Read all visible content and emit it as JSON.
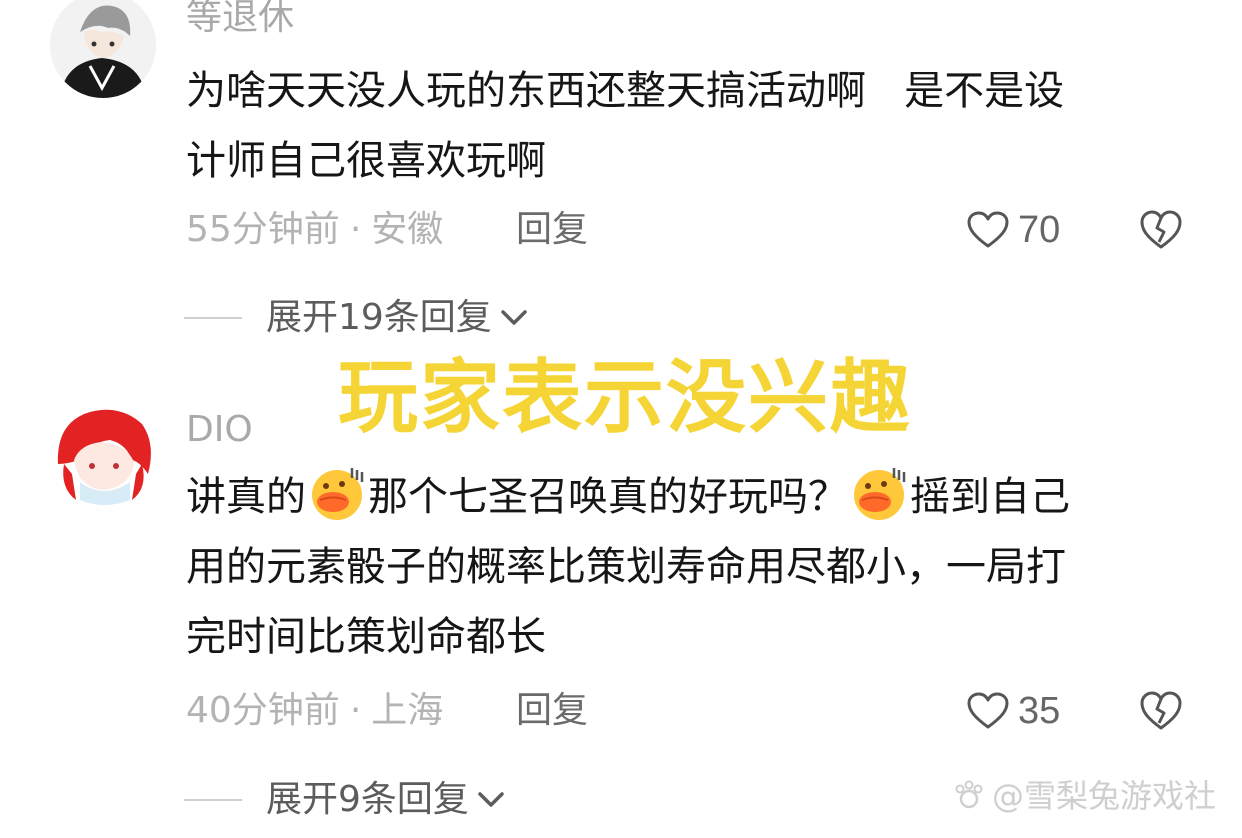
{
  "comments": [
    {
      "username": "等退休",
      "lines": [
        "为啥天天没人玩的东西还整天搞活动啊   是不是设",
        "计师自己很喜欢玩啊"
      ],
      "time": "55分钟前",
      "dot": "·",
      "location": "安徽",
      "reply_label": "回复",
      "likes": "70",
      "expand_label": "展开19条回复"
    },
    {
      "username": "DIO",
      "line1_a": "讲真的",
      "line1_b": "那个七圣召唤真的好玩吗？",
      "line1_c": "摇到自己",
      "lines_rest": [
        "用的元素骰子的概率比策划寿命用尽都小，一局打",
        "完时间比策划命都长"
      ],
      "time": "40分钟前",
      "dot": "·",
      "location": "上海",
      "reply_label": "回复",
      "likes": "35",
      "expand_label": "展开9条回复"
    }
  ],
  "overlay_caption": "玩家表示没兴趣",
  "watermark": "@雪梨兔游戏社",
  "icons": {
    "like": "heart-icon",
    "dislike": "broken-heart-icon",
    "expand": "chevron-down-icon",
    "emoji": "duck-face-emoji"
  },
  "colors": {
    "caption": "#f5d536",
    "meta": "#b3b3b3",
    "text": "#161616"
  }
}
